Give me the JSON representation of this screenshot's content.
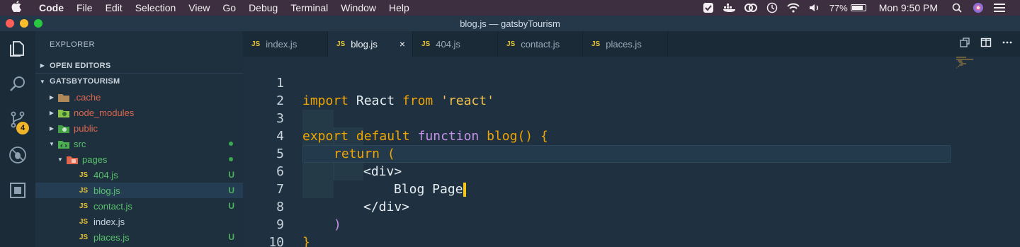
{
  "menubar": {
    "app": "Code",
    "items": [
      "File",
      "Edit",
      "Selection",
      "View",
      "Go",
      "Debug",
      "Terminal",
      "Window",
      "Help"
    ],
    "battery": "77%",
    "clock": "Mon 9:50 PM"
  },
  "window": {
    "title": "blog.js — gatsbyTourism"
  },
  "activity": {
    "scm_badge": "4"
  },
  "explorer": {
    "title": "EXPLORER",
    "open_editors": "OPEN EDITORS",
    "project": "GATSBYTOURISM",
    "tree": [
      {
        "label": ".cache",
        "color": "#e0674e",
        "status": ""
      },
      {
        "label": "node_modules",
        "color": "#e0674e",
        "status": ""
      },
      {
        "label": "public",
        "color": "#e0674e",
        "status": ""
      },
      {
        "label": "src",
        "color": "#57c26b",
        "status": "dot"
      },
      {
        "label": "pages",
        "color": "#57c26b",
        "status": "dot"
      },
      {
        "label": "404.js",
        "color": "#57c26b",
        "status": "U"
      },
      {
        "label": "blog.js",
        "color": "#57c26b",
        "status": "U"
      },
      {
        "label": "contact.js",
        "color": "#57c26b",
        "status": "U"
      },
      {
        "label": "index.js",
        "color": "#c8d3dc",
        "status": ""
      },
      {
        "label": "places.js",
        "color": "#57c26b",
        "status": "U"
      }
    ]
  },
  "tabs": [
    {
      "badge": "JS",
      "label": "index.js"
    },
    {
      "badge": "JS",
      "label": "blog.js",
      "close": "×"
    },
    {
      "badge": "JS",
      "label": "404.js"
    },
    {
      "badge": "JS",
      "label": "contact.js"
    },
    {
      "badge": "JS",
      "label": "places.js"
    }
  ],
  "editor": {
    "line_numbers": [
      "1",
      "2",
      "3",
      "4",
      "5",
      "6",
      "7",
      "8",
      "9",
      "10"
    ],
    "code": {
      "l1_import": "import",
      "l1_react": " React ",
      "l1_from": "from",
      "l1_str": " 'react'",
      "l3_export": "export",
      "l3_default": " default",
      "l3_function": " function",
      "l3_name": " blog",
      "l3_rest": "() {",
      "l4_return": "return",
      "l4_paren": " (",
      "l5": "<div>",
      "l6": "Blog Page",
      "l7": "</div>",
      "l8": ")",
      "l9": "}"
    }
  }
}
